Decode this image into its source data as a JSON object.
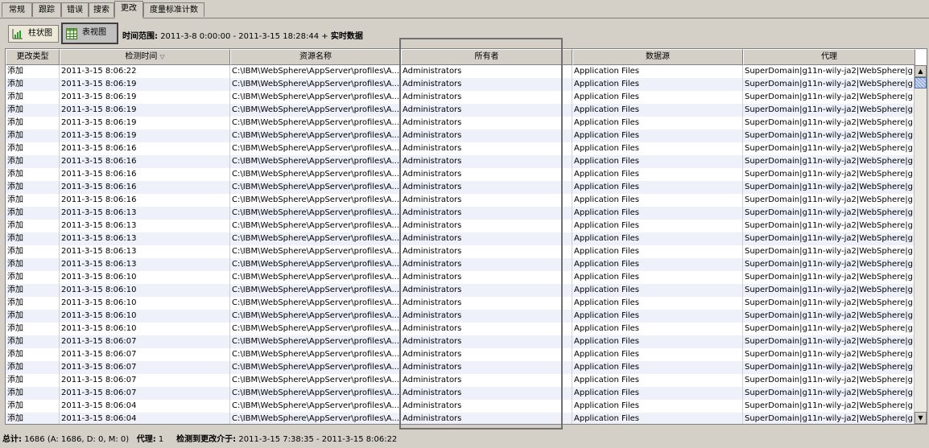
{
  "tabs": [
    {
      "label": "常规",
      "active": false
    },
    {
      "label": "跟踪",
      "active": false
    },
    {
      "label": "错误",
      "active": false
    },
    {
      "label": "搜索",
      "active": false
    },
    {
      "label": "更改",
      "active": true
    },
    {
      "label": "度量标准计数",
      "active": false
    }
  ],
  "toolbar": {
    "chart_view_label": "柱状图",
    "table_view_label": "表视图",
    "time_range_label": "时间范围:",
    "time_range_value": "2011-3-8 0:00:00 - 2011-3-15 18:28:44 + ",
    "realtime_label": "实时数据"
  },
  "table": {
    "columns": [
      "更改类型",
      "检测时间",
      "资源名称",
      "所有者",
      "数据源",
      "代理"
    ],
    "sort_indicator": "▽",
    "rows": [
      [
        "添加",
        "2011-3-15 8:06:22",
        "C:\\IBM\\WebSphere\\AppServer\\profiles\\A...",
        "Administrators",
        "Application Files",
        "SuperDomain|g11n-wily-ja2|WebSphere|g..."
      ],
      [
        "添加",
        "2011-3-15 8:06:19",
        "C:\\IBM\\WebSphere\\AppServer\\profiles\\A...",
        "Administrators",
        "Application Files",
        "SuperDomain|g11n-wily-ja2|WebSphere|g..."
      ],
      [
        "添加",
        "2011-3-15 8:06:19",
        "C:\\IBM\\WebSphere\\AppServer\\profiles\\A...",
        "Administrators",
        "Application Files",
        "SuperDomain|g11n-wily-ja2|WebSphere|g..."
      ],
      [
        "添加",
        "2011-3-15 8:06:19",
        "C:\\IBM\\WebSphere\\AppServer\\profiles\\A...",
        "Administrators",
        "Application Files",
        "SuperDomain|g11n-wily-ja2|WebSphere|g..."
      ],
      [
        "添加",
        "2011-3-15 8:06:19",
        "C:\\IBM\\WebSphere\\AppServer\\profiles\\A...",
        "Administrators",
        "Application Files",
        "SuperDomain|g11n-wily-ja2|WebSphere|g..."
      ],
      [
        "添加",
        "2011-3-15 8:06:19",
        "C:\\IBM\\WebSphere\\AppServer\\profiles\\A...",
        "Administrators",
        "Application Files",
        "SuperDomain|g11n-wily-ja2|WebSphere|g..."
      ],
      [
        "添加",
        "2011-3-15 8:06:16",
        "C:\\IBM\\WebSphere\\AppServer\\profiles\\A...",
        "Administrators",
        "Application Files",
        "SuperDomain|g11n-wily-ja2|WebSphere|g..."
      ],
      [
        "添加",
        "2011-3-15 8:06:16",
        "C:\\IBM\\WebSphere\\AppServer\\profiles\\A...",
        "Administrators",
        "Application Files",
        "SuperDomain|g11n-wily-ja2|WebSphere|g..."
      ],
      [
        "添加",
        "2011-3-15 8:06:16",
        "C:\\IBM\\WebSphere\\AppServer\\profiles\\A...",
        "Administrators",
        "Application Files",
        "SuperDomain|g11n-wily-ja2|WebSphere|g..."
      ],
      [
        "添加",
        "2011-3-15 8:06:16",
        "C:\\IBM\\WebSphere\\AppServer\\profiles\\A...",
        "Administrators",
        "Application Files",
        "SuperDomain|g11n-wily-ja2|WebSphere|g..."
      ],
      [
        "添加",
        "2011-3-15 8:06:16",
        "C:\\IBM\\WebSphere\\AppServer\\profiles\\A...",
        "Administrators",
        "Application Files",
        "SuperDomain|g11n-wily-ja2|WebSphere|g..."
      ],
      [
        "添加",
        "2011-3-15 8:06:13",
        "C:\\IBM\\WebSphere\\AppServer\\profiles\\A...",
        "Administrators",
        "Application Files",
        "SuperDomain|g11n-wily-ja2|WebSphere|g..."
      ],
      [
        "添加",
        "2011-3-15 8:06:13",
        "C:\\IBM\\WebSphere\\AppServer\\profiles\\A...",
        "Administrators",
        "Application Files",
        "SuperDomain|g11n-wily-ja2|WebSphere|g..."
      ],
      [
        "添加",
        "2011-3-15 8:06:13",
        "C:\\IBM\\WebSphere\\AppServer\\profiles\\A...",
        "Administrators",
        "Application Files",
        "SuperDomain|g11n-wily-ja2|WebSphere|g..."
      ],
      [
        "添加",
        "2011-3-15 8:06:13",
        "C:\\IBM\\WebSphere\\AppServer\\profiles\\A...",
        "Administrators",
        "Application Files",
        "SuperDomain|g11n-wily-ja2|WebSphere|g..."
      ],
      [
        "添加",
        "2011-3-15 8:06:13",
        "C:\\IBM\\WebSphere\\AppServer\\profiles\\A...",
        "Administrators",
        "Application Files",
        "SuperDomain|g11n-wily-ja2|WebSphere|g..."
      ],
      [
        "添加",
        "2011-3-15 8:06:10",
        "C:\\IBM\\WebSphere\\AppServer\\profiles\\A...",
        "Administrators",
        "Application Files",
        "SuperDomain|g11n-wily-ja2|WebSphere|g..."
      ],
      [
        "添加",
        "2011-3-15 8:06:10",
        "C:\\IBM\\WebSphere\\AppServer\\profiles\\A...",
        "Administrators",
        "Application Files",
        "SuperDomain|g11n-wily-ja2|WebSphere|g..."
      ],
      [
        "添加",
        "2011-3-15 8:06:10",
        "C:\\IBM\\WebSphere\\AppServer\\profiles\\A...",
        "Administrators",
        "Application Files",
        "SuperDomain|g11n-wily-ja2|WebSphere|g..."
      ],
      [
        "添加",
        "2011-3-15 8:06:10",
        "C:\\IBM\\WebSphere\\AppServer\\profiles\\A...",
        "Administrators",
        "Application Files",
        "SuperDomain|g11n-wily-ja2|WebSphere|g..."
      ],
      [
        "添加",
        "2011-3-15 8:06:10",
        "C:\\IBM\\WebSphere\\AppServer\\profiles\\A...",
        "Administrators",
        "Application Files",
        "SuperDomain|g11n-wily-ja2|WebSphere|g..."
      ],
      [
        "添加",
        "2011-3-15 8:06:07",
        "C:\\IBM\\WebSphere\\AppServer\\profiles\\A...",
        "Administrators",
        "Application Files",
        "SuperDomain|g11n-wily-ja2|WebSphere|g..."
      ],
      [
        "添加",
        "2011-3-15 8:06:07",
        "C:\\IBM\\WebSphere\\AppServer\\profiles\\A...",
        "Administrators",
        "Application Files",
        "SuperDomain|g11n-wily-ja2|WebSphere|g..."
      ],
      [
        "添加",
        "2011-3-15 8:06:07",
        "C:\\IBM\\WebSphere\\AppServer\\profiles\\A...",
        "Administrators",
        "Application Files",
        "SuperDomain|g11n-wily-ja2|WebSphere|g..."
      ],
      [
        "添加",
        "2011-3-15 8:06:07",
        "C:\\IBM\\WebSphere\\AppServer\\profiles\\A...",
        "Administrators",
        "Application Files",
        "SuperDomain|g11n-wily-ja2|WebSphere|g..."
      ],
      [
        "添加",
        "2011-3-15 8:06:07",
        "C:\\IBM\\WebSphere\\AppServer\\profiles\\A...",
        "Administrators",
        "Application Files",
        "SuperDomain|g11n-wily-ja2|WebSphere|g..."
      ],
      [
        "添加",
        "2011-3-15 8:06:04",
        "C:\\IBM\\WebSphere\\AppServer\\profiles\\A...",
        "Administrators",
        "Application Files",
        "SuperDomain|g11n-wily-ja2|WebSphere|g..."
      ],
      [
        "添加",
        "2011-3-15 8:06:04",
        "C:\\IBM\\WebSphere\\AppServer\\profiles\\A...",
        "Administrators",
        "Application Files",
        "SuperDomain|g11n-wily-ja2|WebSphere|g..."
      ]
    ]
  },
  "scrollbar": {
    "up_arrow": "▲",
    "down_arrow": "▼"
  },
  "status": {
    "total_label": "总计:",
    "total_value": "1686 (A: 1686, D: 0, M: 0)",
    "agent_label": "代理:",
    "agent_value": "1",
    "detected_label": "检测到更改介于:",
    "detected_value": "2011-3-15 7:38:35 - 2011-3-15 8:06:22"
  }
}
